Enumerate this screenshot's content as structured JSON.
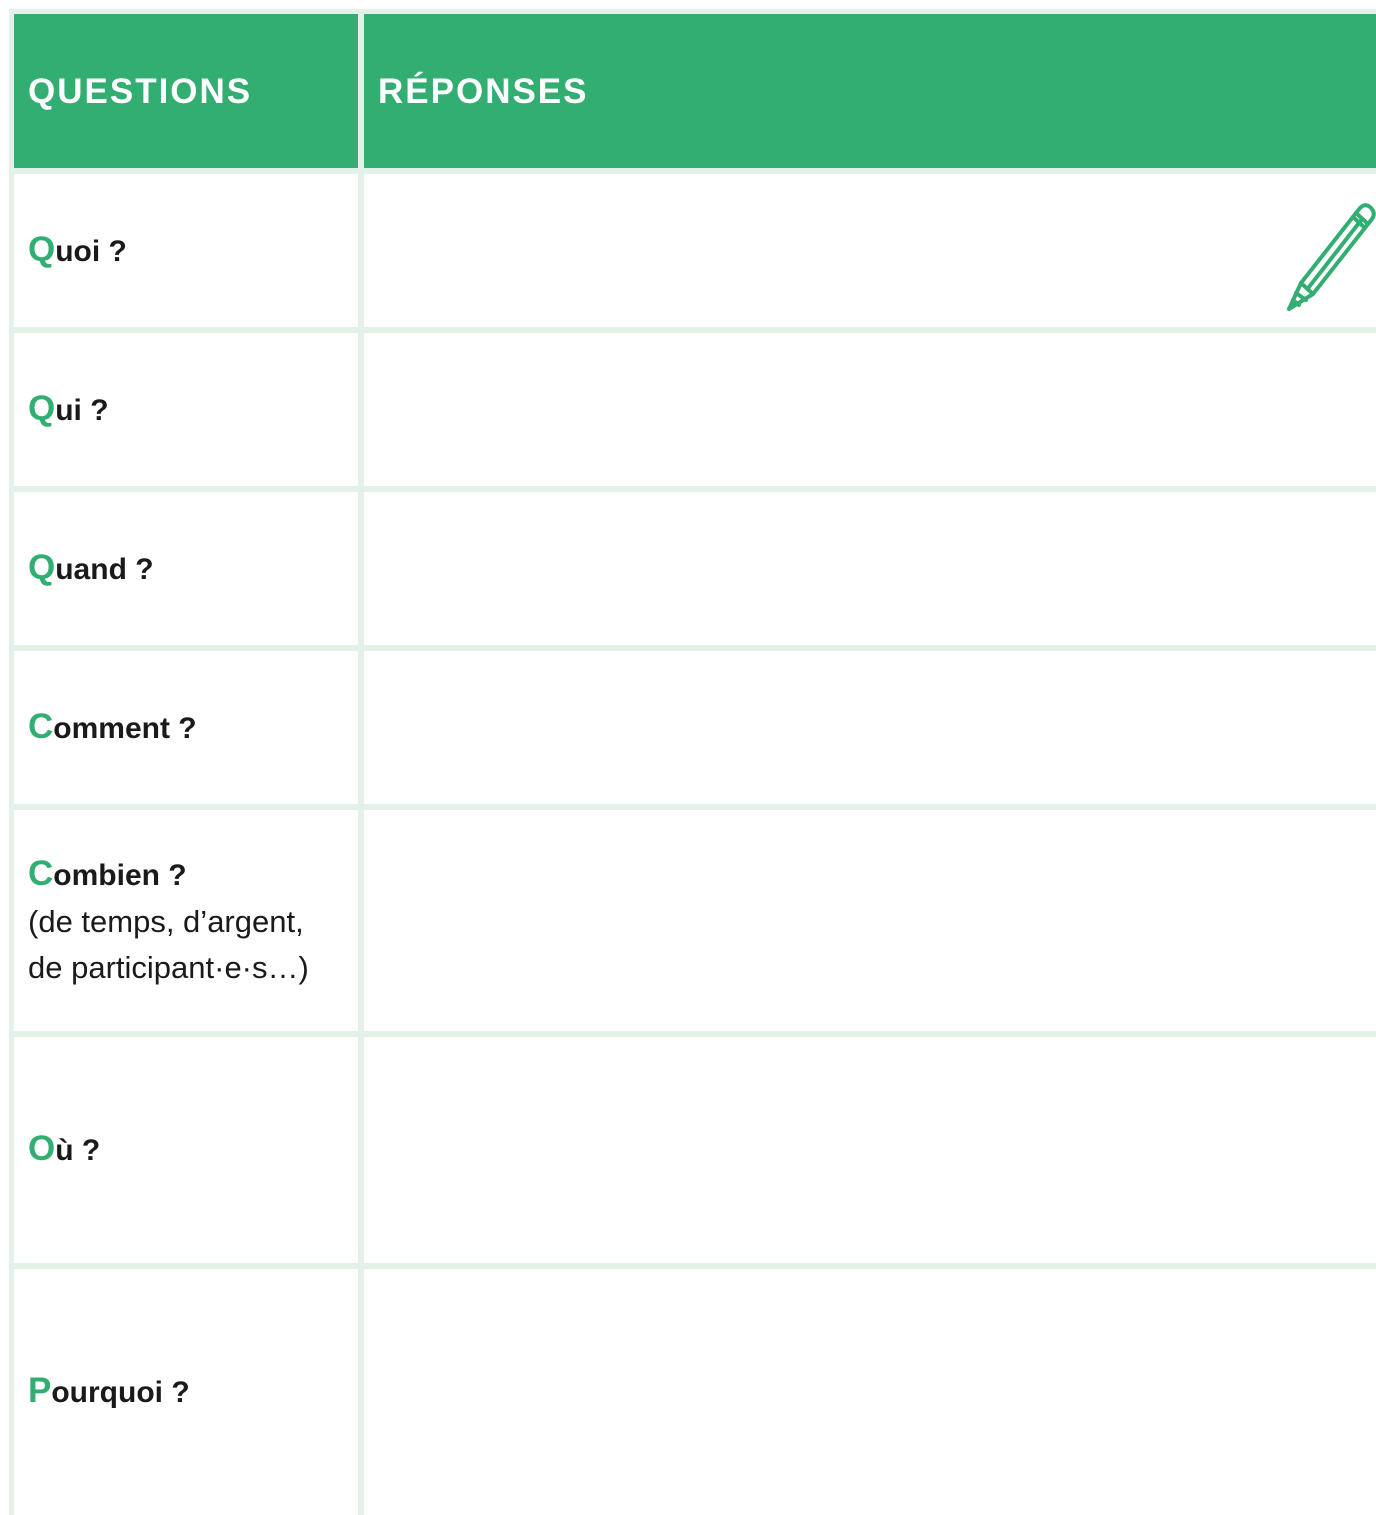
{
  "table": {
    "header": {
      "questions_label": "QUESTIONS",
      "answers_label": "RÉPONSES"
    },
    "rows": [
      {
        "initial": "Q",
        "rest": "uoi ?",
        "note_line1": "",
        "note_line2": ""
      },
      {
        "initial": "Q",
        "rest": "ui ?",
        "note_line1": "",
        "note_line2": ""
      },
      {
        "initial": "Q",
        "rest": "uand ?",
        "note_line1": "",
        "note_line2": ""
      },
      {
        "initial": "C",
        "rest": "omment ?",
        "note_line1": "",
        "note_line2": ""
      },
      {
        "initial": "C",
        "rest": "ombien ?",
        "note_line1": "(de temps, d’argent,",
        "note_line2": "de participant·e·s…)"
      },
      {
        "initial": "O",
        "rest": "ù ?",
        "note_line1": "",
        "note_line2": ""
      },
      {
        "initial": "P",
        "rest": "ourquoi ?",
        "note_line1": "",
        "note_line2": ""
      }
    ]
  },
  "icons": {
    "pencil": "pencil-icon"
  },
  "colors": {
    "accent_green": "#33ae72",
    "grid_line": "#e3f1e8",
    "text": "#1a1a1a"
  }
}
